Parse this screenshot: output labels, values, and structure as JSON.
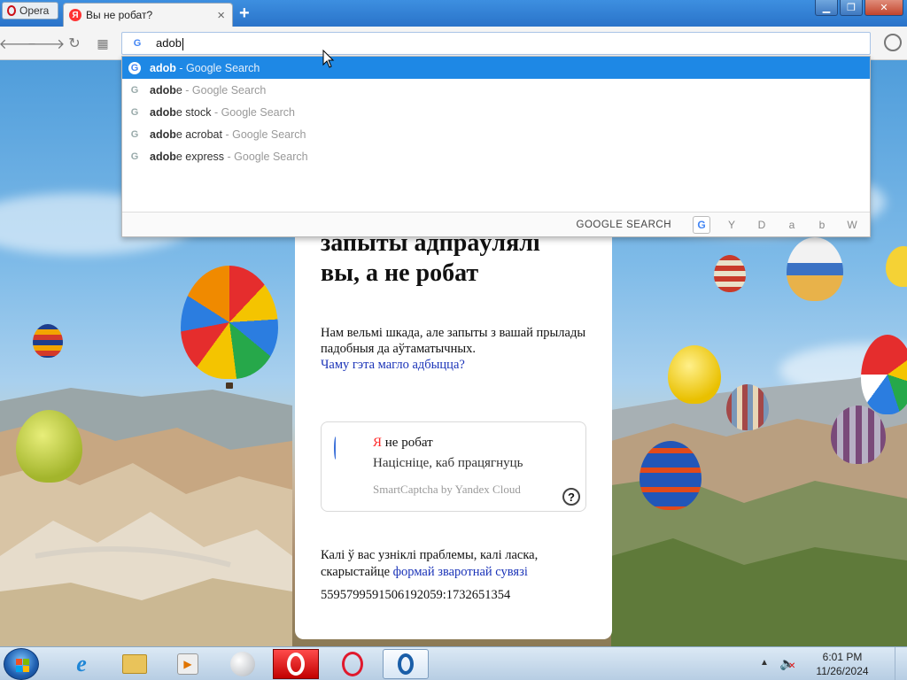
{
  "browser": {
    "menu_label": "Opera",
    "tab_title": "Вы не робат?",
    "tab_favicon_letter": "Я",
    "new_tab_icon": "plus-icon",
    "window_buttons": [
      "minimize-icon",
      "maximize-icon",
      "close-icon"
    ]
  },
  "toolbar": {
    "nav_icons": [
      "back-icon",
      "forward-icon",
      "reload-icon",
      "speed-dial-icon"
    ],
    "search_engine_icon": "G",
    "address_value": "adob",
    "account_icon": "account-icon"
  },
  "dropdown": {
    "suggestions": [
      {
        "bold": "adob",
        "rest": "",
        "suffix": " - Google Search"
      },
      {
        "bold": "adob",
        "rest": "e",
        "suffix": " - Google Search"
      },
      {
        "bold": "adob",
        "rest": "e stock",
        "suffix": " - Google Search"
      },
      {
        "bold": "adob",
        "rest": "e acrobat",
        "suffix": " - Google Search"
      },
      {
        "bold": "adob",
        "rest": "e express",
        "suffix": " - Google Search"
      }
    ],
    "engine_label": "GOOGLE SEARCH",
    "engines": [
      "G",
      "Y",
      "D",
      "a",
      "b",
      "W"
    ]
  },
  "page": {
    "heading_line1": "запыты адпраўлялі",
    "heading_line2": "вы, а не робат",
    "para1": "Нам вельмі шкада, але запыты з вашай прылады падобныя да аўтаматычных.",
    "para1_link": "Чаму гэта магло адбыцца?",
    "captcha_ya": "Я",
    "captcha_title": " не робат",
    "captcha_sub": "Націсніце, каб працягнуць",
    "captcha_brand": "SmartCaptcha by Yandex Cloud",
    "captcha_help": "?",
    "para2": "Калі ў вас узніклі праблемы, калі ласка, скарыстайце ",
    "para2_link": "формай зваротнай сувязі",
    "code": "5595799591506192059:1732651354"
  },
  "taskbar": {
    "items": [
      "start-button",
      "internet-explorer",
      "windows-explorer",
      "media-player",
      "app-sphere",
      "opera-red",
      "opera-ring",
      "opera-blue"
    ],
    "time": "6:01 PM",
    "date": "11/26/2024"
  }
}
